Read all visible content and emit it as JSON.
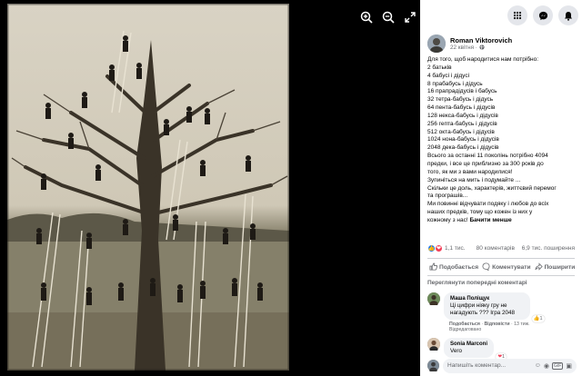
{
  "viewer": {
    "icons": [
      "zoom-in-icon",
      "zoom-out-icon",
      "fullscreen-icon"
    ]
  },
  "topbar": {
    "icons": [
      "grid-menu-icon",
      "messenger-icon",
      "notifications-icon"
    ]
  },
  "post": {
    "author": "Roman Viktorovich",
    "date": "22 квітня ·",
    "lines": [
      "Для того, щоб народитися нам потрібно:",
      "2 батьків",
      "4 бабусі і дідусі",
      "8 прабабусь і дідусь",
      "16 прапрадідусів і бабусь",
      "32 тетра-бабусь і дідусь",
      "64 пента-бабусь і дідусів",
      "128 некса-бабусь і дідусів",
      "256 гепта-бабусь і дідусів",
      "512 окта-бабусь і дідусів",
      "1024 нона-бабусь і дідусів",
      "2048 дека-бабусь і дідусів",
      "Всього за останні 11 поколінь потрібно 4094",
      "предки, і все це приблизно за 300 років до",
      "того, як ми з вами народилися!",
      "Зупиніться на мить і подумайте ...",
      "Скільки це доль, характерів, життєвий перемог",
      "та програшів...",
      "Ми повинні відчувати подяку і любов до всіх",
      "наших предків, тому що кожен із них у",
      "кожному з нас! "
    ],
    "see_less": "Бачити менше"
  },
  "stats": {
    "reactions": "1,1 тис.",
    "comments": "80 коментарів",
    "shares": "6,9 тис. поширення"
  },
  "actions": {
    "like": "Подобається",
    "comment": "Коментувати",
    "share": "Поширити"
  },
  "previous_comments": "Переглянути попередні коментарі",
  "comments": [
    {
      "author": "Маша Поліщук",
      "text1": "Ці цифри ніяку гру не",
      "text2": "нагадують ??? Ігра 2048",
      "reaction_count": "1",
      "meta_like": "Подобається",
      "meta_reply": "Відповісти",
      "meta_time": "· 13 тиж.",
      "edited": "Відредаговано"
    },
    {
      "author": "Sonia Marconi",
      "text1": "Vero",
      "reaction_count": "1"
    }
  ],
  "input": {
    "placeholder": "Напишіть коментар..."
  }
}
